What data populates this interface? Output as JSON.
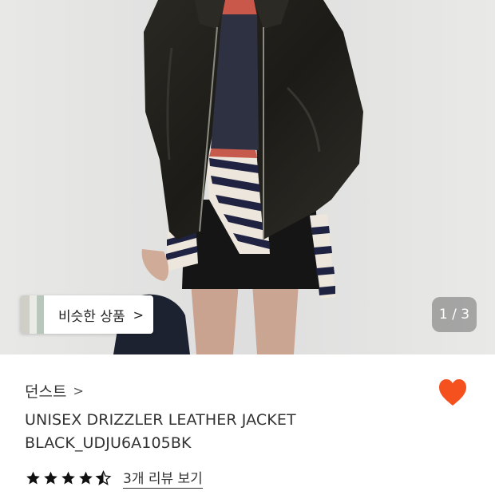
{
  "gallery": {
    "similar_label": "비슷한 상품",
    "chevron": "chevron-right-icon",
    "counter": "1 / 3"
  },
  "product": {
    "brand": "던스트",
    "title_line1": "UNISEX DRIZZLER LEATHER JACKET",
    "title_line2": "BLACK_UDJU6A105BK",
    "liked": true,
    "rating": 4.5,
    "review_link": "3개 리뷰 보기"
  },
  "colors": {
    "heart": "#f4511e",
    "star": "#111111",
    "counter_bg": "#7a7a7a"
  }
}
